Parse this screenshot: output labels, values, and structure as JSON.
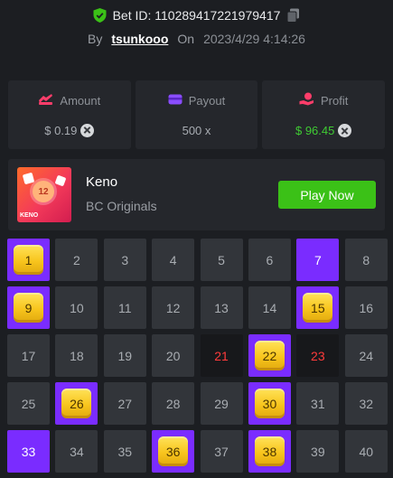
{
  "header": {
    "bet_id": "Bet ID: 110289417221979417",
    "by_label": "By",
    "username": "tsunkooo",
    "on_label": "On",
    "datetime": "2023/4/29 4:14:26"
  },
  "stats": [
    {
      "label": "Amount",
      "value": "$ 0.19",
      "icon": "amount-icon",
      "color": "#ff3d6a"
    },
    {
      "label": "Payout",
      "value": "500 x",
      "icon": "payout-icon",
      "color": "#8a4dff"
    },
    {
      "label": "Profit",
      "value": "$ 96.45",
      "icon": "profit-icon",
      "color": "#ff3d6a"
    }
  ],
  "game": {
    "thumb_number": "12",
    "thumb_label": "KENO",
    "name": "Keno",
    "provider": "BC Originals",
    "play_label": "Play Now"
  },
  "colors": {
    "accent_green": "#3bc117",
    "picked_purple": "#7a2cff",
    "miss_red": "#ff3b3b",
    "hit_gold": "#f8c51d"
  },
  "tiles": [
    {
      "n": "1",
      "state": "hit"
    },
    {
      "n": "2",
      "state": "none"
    },
    {
      "n": "3",
      "state": "none"
    },
    {
      "n": "4",
      "state": "none"
    },
    {
      "n": "5",
      "state": "none"
    },
    {
      "n": "6",
      "state": "none"
    },
    {
      "n": "7",
      "state": "picked"
    },
    {
      "n": "8",
      "state": "none"
    },
    {
      "n": "9",
      "state": "hit"
    },
    {
      "n": "10",
      "state": "none"
    },
    {
      "n": "11",
      "state": "none"
    },
    {
      "n": "12",
      "state": "none"
    },
    {
      "n": "13",
      "state": "none"
    },
    {
      "n": "14",
      "state": "none"
    },
    {
      "n": "15",
      "state": "hit"
    },
    {
      "n": "16",
      "state": "none"
    },
    {
      "n": "17",
      "state": "none"
    },
    {
      "n": "18",
      "state": "none"
    },
    {
      "n": "19",
      "state": "none"
    },
    {
      "n": "20",
      "state": "none"
    },
    {
      "n": "21",
      "state": "miss"
    },
    {
      "n": "22",
      "state": "hit"
    },
    {
      "n": "23",
      "state": "miss"
    },
    {
      "n": "24",
      "state": "none"
    },
    {
      "n": "25",
      "state": "none"
    },
    {
      "n": "26",
      "state": "hit"
    },
    {
      "n": "27",
      "state": "none"
    },
    {
      "n": "28",
      "state": "none"
    },
    {
      "n": "29",
      "state": "none"
    },
    {
      "n": "30",
      "state": "hit"
    },
    {
      "n": "31",
      "state": "none"
    },
    {
      "n": "32",
      "state": "none"
    },
    {
      "n": "33",
      "state": "picked"
    },
    {
      "n": "34",
      "state": "none"
    },
    {
      "n": "35",
      "state": "none"
    },
    {
      "n": "36",
      "state": "hit"
    },
    {
      "n": "37",
      "state": "none"
    },
    {
      "n": "38",
      "state": "hit"
    },
    {
      "n": "39",
      "state": "none"
    },
    {
      "n": "40",
      "state": "none"
    }
  ]
}
